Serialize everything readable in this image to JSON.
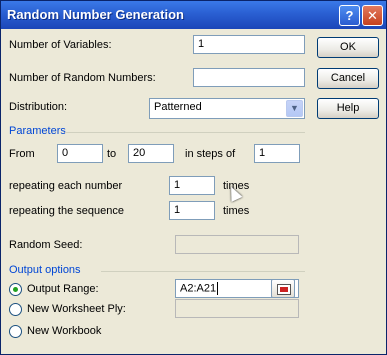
{
  "window": {
    "title": "Random Number Generation"
  },
  "labels": {
    "num_variables": "Number of Variables:",
    "num_random": "Number of Random Numbers:",
    "distribution": "Distribution:",
    "parameters": "Parameters",
    "from": "From",
    "to": "to",
    "in_steps_of": "in steps of",
    "repeating_each": "repeating each number",
    "times1": "times",
    "repeating_seq": "repeating the sequence",
    "times2": "times",
    "random_seed": "Random Seed:",
    "output_options": "Output options",
    "output_range": "Output Range:",
    "new_worksheet": "New Worksheet Ply:",
    "new_workbook": "New Workbook"
  },
  "values": {
    "num_variables": "1",
    "num_random": "",
    "distribution": "Patterned",
    "from": "0",
    "to": "20",
    "steps": "1",
    "repeat_each": "1",
    "repeat_seq": "1",
    "random_seed": "",
    "output_range": "A2:A21",
    "new_worksheet": ""
  },
  "buttons": {
    "ok": "OK",
    "cancel": "Cancel",
    "help": "Help"
  },
  "title_buttons": {
    "help": "?",
    "close": "✕"
  },
  "selected_output": "output_range",
  "icons": [
    "help-icon",
    "close-icon",
    "dropdown-arrow-icon",
    "collapse-dialog-icon",
    "mouse-cursor-icon"
  ],
  "colors": {
    "titlebar": "#2A5FD2",
    "group_title": "#0046D5",
    "dialog_bg": "#ECE9D8"
  }
}
